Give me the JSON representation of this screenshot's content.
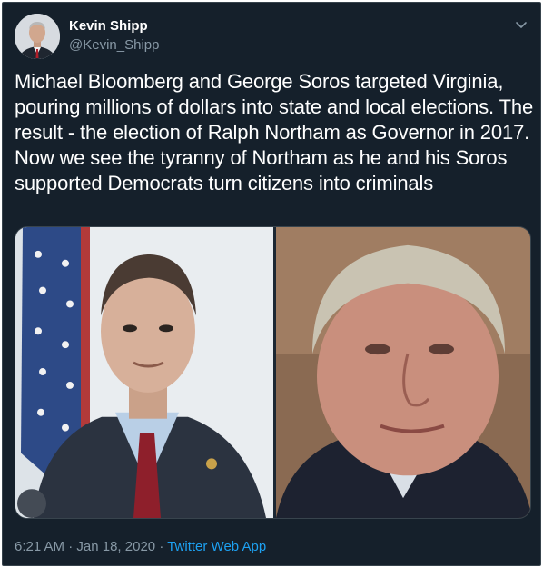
{
  "tweet": {
    "author_name": "Kevin Shipp",
    "author_handle": "@Kevin_Shipp",
    "text": "Michael Bloomberg and George Soros targeted Virginia, pouring millions of dollars into state and local elections. The result - the election of Ralph Northam as Governor in 2017. Now we see the tyranny of Northam as he and his Soros supported Democrats turn citizens into criminals",
    "time": "6:21 AM",
    "date": "Jan 18, 2020",
    "separator": "·",
    "source_app": "Twitter Web App"
  },
  "icons": {
    "menu": "chevron-down-icon"
  },
  "colors": {
    "background": "#15202b",
    "text": "#ffffff",
    "muted": "#8899a6",
    "link": "#1da1f2"
  }
}
